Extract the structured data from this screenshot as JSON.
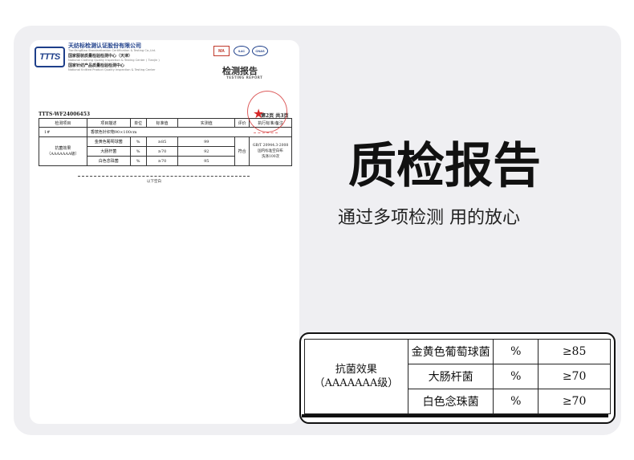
{
  "report": {
    "org_name_cn": "天纺标检测认证股份有限公司",
    "org_name_en": "TianFangBiao Standardization Certification & Testing Co.,Ltd.",
    "center1_cn": "国家服装质量检验检测中心（天津）",
    "center1_en": "National Clothing Quality Inspection & Testing Center ( Tianjin )",
    "center2_cn": "国家针纺产品质量检验检测中心",
    "center2_en": "National Knitted Product Quality Inspection & Testing Center",
    "logo_text": "TTTS",
    "cert_marks": [
      "MA",
      "ILAC",
      "CNAS"
    ],
    "title": "检测报告",
    "title_en": "TESTING REPORT",
    "report_no": "TTTS-WF24006453",
    "page": "第2页  共3页",
    "headers": [
      "检测项目",
      "项目描述",
      "单位",
      "标准值",
      "实测值",
      "评价",
      "执行标准/备注"
    ],
    "sample_id": "1#",
    "sample_desc": "香槟色针织物90×100cm",
    "category": "抗菌效果\n（AAAAAAA级）",
    "rows": [
      {
        "item": "金黄色葡萄球菌",
        "unit": "%",
        "std": "≥85",
        "measured": "99"
      },
      {
        "item": "大肠杆菌",
        "unit": "%",
        "std": "≥70",
        "measured": "92"
      },
      {
        "item": "白色念珠菌",
        "unit": "%",
        "std": "≥70",
        "measured": "95"
      }
    ],
    "evaluation": "符合",
    "standard_note": "GB/T 20944.3-2008\n国内标准空白布\n洗涤100次",
    "end_note": "以下空白"
  },
  "headline": {
    "title": "质检报告",
    "subtitle": "通过多项检测 用的放心"
  },
  "zoom": {
    "category": "抗菌效果\n（AAAAAAA级）",
    "rows": [
      {
        "item": "金黄色葡萄球菌",
        "unit": "%",
        "std": "≥85"
      },
      {
        "item": "大肠杆菌",
        "unit": "%",
        "std": "≥70"
      },
      {
        "item": "白色念珠菌",
        "unit": "%",
        "std": "≥70"
      }
    ]
  },
  "colors": {
    "panel_bg": "#efeff2",
    "brand_blue": "#1e3f8a",
    "seal_red": "#d62828"
  }
}
